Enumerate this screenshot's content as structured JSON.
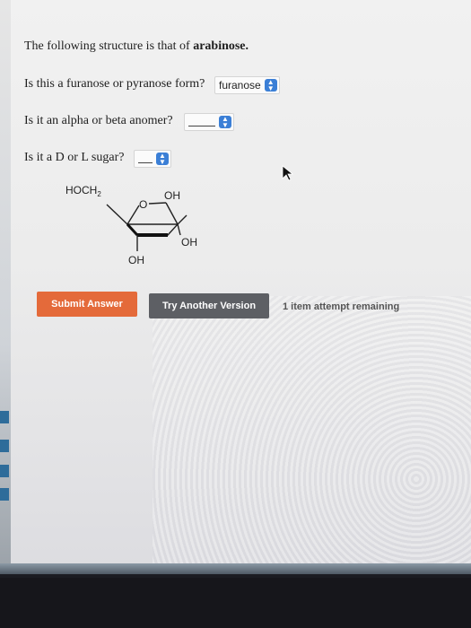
{
  "question": {
    "intro_prefix": "The following structure is that of",
    "intro_sugar": "arabinose.",
    "q1": "Is this a furanose or pyranose form?",
    "q1_answer": "furanose",
    "q2": "Is it an alpha or beta anomer?",
    "q3": "Is it a D or L sugar?"
  },
  "structure": {
    "hoch2": "HOCH",
    "hoch2_sub": "2",
    "ring_o": "O",
    "oh_top": "OH",
    "oh_right": "OH",
    "oh_bottom": "OH"
  },
  "buttons": {
    "submit": "Submit Answer",
    "try_another": "Try Another Version"
  },
  "attempts": "1 item attempt remaining",
  "colors": {
    "submit": "#e46a3a",
    "try_another": "#5d5f64",
    "select_arrow": "#3b7fd6"
  }
}
